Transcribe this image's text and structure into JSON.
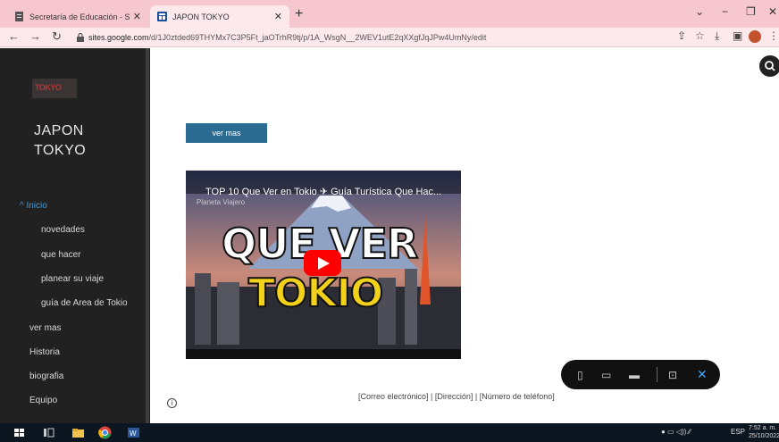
{
  "browser": {
    "tabs": [
      {
        "title": "Secretaría de Educación - Secre"
      },
      {
        "title": "JAPON TOKYO"
      }
    ],
    "url_host": "sites.google.com",
    "url_path": "/d/1J0ztded69THYMx7C3P5Ft_jaOTrhR9tj/p/1A_WsgN__2WEV1utE2qXXgfJqJPw4UmNy/edit"
  },
  "sidebar": {
    "site_title_line1": "JAPON",
    "site_title_line2": "TOKYO",
    "logo_text": "TOKYO",
    "items": [
      {
        "label": "^ Inicio"
      },
      {
        "label": "novedades"
      },
      {
        "label": "que hacer"
      },
      {
        "label": "planear su viaje"
      },
      {
        "label": "guía de Area de Tokio"
      },
      {
        "label": "ver mas"
      },
      {
        "label": "Historia"
      },
      {
        "label": "biografia"
      },
      {
        "label": "Equipo"
      }
    ]
  },
  "main": {
    "button_label": "ver mas",
    "video": {
      "title": "TOP 10 Que Ver en Tokio ✈ Guía Turística Que Hac...",
      "channel": "Planeta Viajero",
      "thumb_line1": "QUE VER",
      "thumb_line2": "TOKIO"
    },
    "footer": "[Correo electrónico]  |  [Dirección]  |  [Número de teléfono]"
  },
  "taskbar": {
    "lang": "ESP",
    "time": "7:52 a. m.",
    "date": "25/10/2022"
  }
}
